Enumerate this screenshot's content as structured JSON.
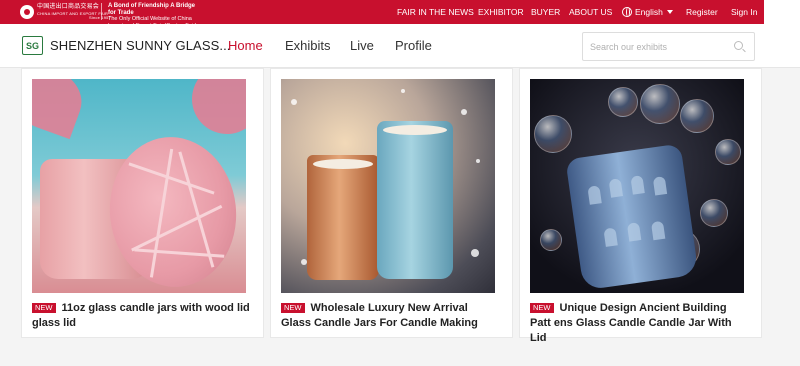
{
  "topbar": {
    "fair_name_cn": "中国进出口商品交易会",
    "fair_name_en": "CHINA IMPORT AND EXPORT FAIR",
    "since": "Since 1957",
    "tagline_bold": "A Bond of Friendship A Bridge for Trade",
    "tagline_sub": "The Only Official Website of China Import and Export Fair (Canton Fair)",
    "nav": {
      "fair_in_news": "FAIR IN THE NEWS",
      "exhibitor": "EXHIBITOR",
      "buyer": "BUYER",
      "about_us": "ABOUT US",
      "language": "English",
      "register": "Register",
      "sign_in": "Sign In"
    }
  },
  "header": {
    "brand_logo_text": "SG",
    "brand_name": "SHENZHEN SUNNY GLASS...",
    "nav": {
      "home": "Home",
      "exhibits": "Exhibits",
      "live": "Live",
      "profile": "Profile"
    },
    "search_placeholder": "Search our exhibits"
  },
  "products": [
    {
      "badge": "NEW",
      "title": "11oz glass candle jars with wood lid glass lid"
    },
    {
      "badge": "NEW",
      "title": "Wholesale Luxury New Arrival Glass Candle Jars For Candle Making"
    },
    {
      "badge": "NEW",
      "title": "Unique Design Ancient Building Patt ens Glass Candle Candle Jar With Lid"
    }
  ],
  "colors": {
    "brand_red": "#c8102e",
    "nav_active": "#c8102e"
  }
}
